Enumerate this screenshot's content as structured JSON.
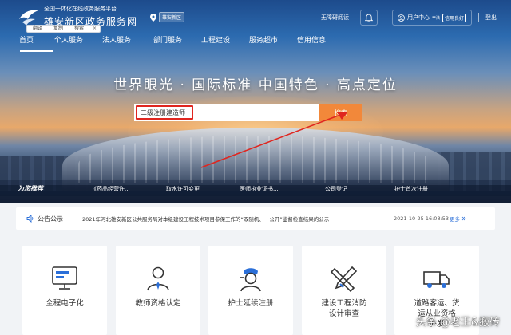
{
  "brand": {
    "subtitle": "全国一体化在线政务服务平台",
    "title": "雄安新区政务服务网"
  },
  "translate_bar": {
    "translate": "翻译",
    "copy": "复制",
    "search": "搜索",
    "close": "×"
  },
  "location": {
    "label": "雄安新区"
  },
  "header": {
    "accessible": "无障碍阅读",
    "user_center": "用户中心",
    "user_name": "**法",
    "credit_badge": "信用良好",
    "logout": "登出"
  },
  "nav": {
    "items": [
      "首页",
      "个人服务",
      "法人服务",
      "部门服务",
      "工程建设",
      "服务超市",
      "信用信息"
    ],
    "active": "首页"
  },
  "hero": {
    "slogan": "世界眼光 · 国际标准    中国特色 · 高点定位"
  },
  "search": {
    "value": "二级注册建造师",
    "button": "搜索"
  },
  "quick_bar": {
    "tag": "为您推荐",
    "items": [
      "《药品经营许...",
      "取水许可变更",
      "医师执业证书...",
      "公司登记",
      "护士首次注册"
    ]
  },
  "notice": {
    "title": "公告公示",
    "text": "2021年河北雄安新区公共服务局对本级建设工程技术项目参保工作的“双随机、一公开”监督检查结果的公示",
    "date": "2021-10-25 16:08:53",
    "more": "更多"
  },
  "cards": [
    {
      "label": "全程电子化",
      "icon": "monitor-icon"
    },
    {
      "label": "教师资格认定",
      "icon": "teacher-icon"
    },
    {
      "label": "护士延续注册",
      "icon": "nurse-icon"
    },
    {
      "label": "建设工程消防\n设计审查",
      "icon": "drafting-tools-icon"
    },
    {
      "label": "道路客运、货\n运从业资格\n补发",
      "icon": "truck-icon"
    }
  ],
  "watermark": "头条 @老王&搬砖",
  "colors": {
    "accent_orange": "#f2883a",
    "highlight_red": "#e0261f",
    "link_blue": "#2b6fd8"
  }
}
